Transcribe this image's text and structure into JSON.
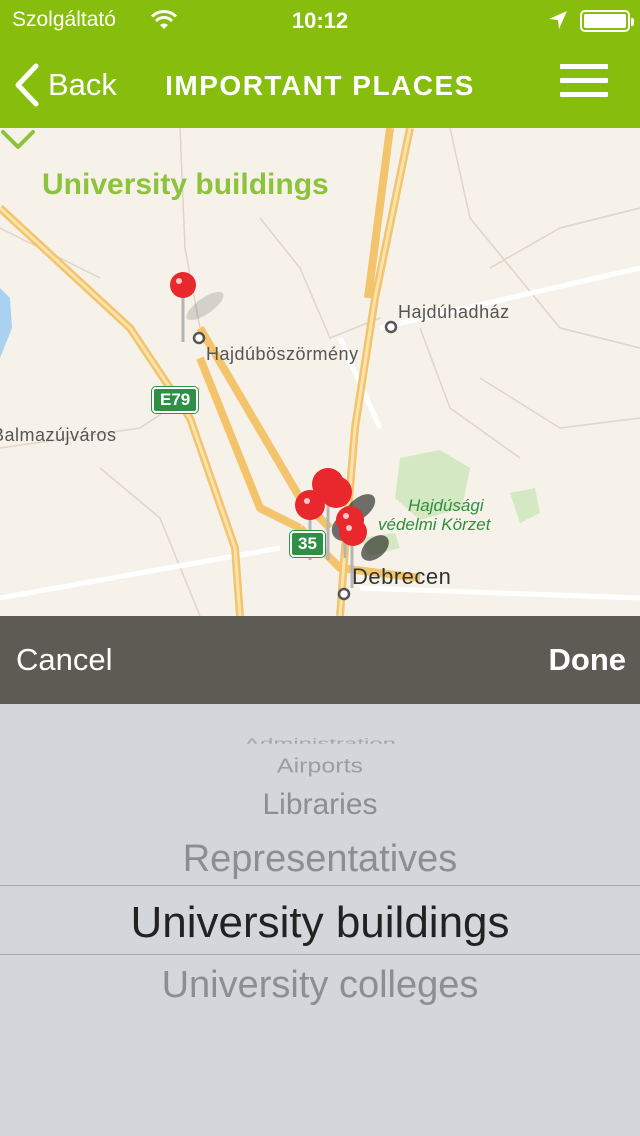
{
  "status": {
    "carrier": "Szolgáltató",
    "time": "10:12"
  },
  "nav": {
    "back_label": "Back",
    "title": "IMPORTANT PLACES"
  },
  "map": {
    "heading": "University buildings",
    "places": [
      "Hajdúhadház",
      "Hajdúböszörmény",
      "Balmazújváros",
      "Debrecen"
    ],
    "park": [
      "Hajdúsági",
      "védelmi Körzet"
    ],
    "roads": [
      "E79",
      "35"
    ]
  },
  "toolbar": {
    "cancel_label": "Cancel",
    "done_label": "Done"
  },
  "picker": {
    "options": [
      "Administration",
      "Airports",
      "Libraries",
      "Representatives",
      "University buildings",
      "University colleges"
    ],
    "selected": "University buildings"
  },
  "colors": {
    "accent": "#87bd0c",
    "heading": "#8dc33a",
    "pin": "#e8282c"
  }
}
